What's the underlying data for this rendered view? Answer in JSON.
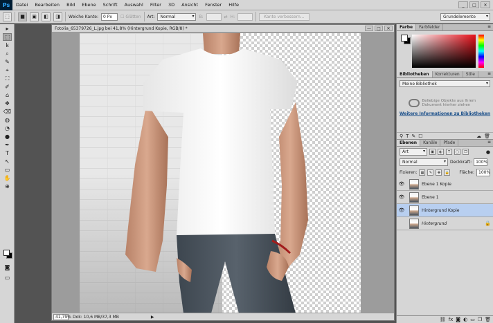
{
  "app": {
    "logo": "Ps"
  },
  "menu": [
    "Datei",
    "Bearbeiten",
    "Bild",
    "Ebene",
    "Schrift",
    "Auswahl",
    "Filter",
    "3D",
    "Ansicht",
    "Fenster",
    "Hilfe"
  ],
  "window_controls": [
    "_",
    "□",
    "✕"
  ],
  "options": {
    "soft_edge_label": "Weiche Kante:",
    "soft_edge_value": "0 Px",
    "smooth_label": "Glätten",
    "style_label": "Art:",
    "style_value": "Normal",
    "width_label": "B:",
    "height_label": "H:",
    "refine_button": "Kante verbessern...",
    "workspace": "Grundelemente"
  },
  "tools": [
    "▸",
    "⬚",
    "ꝃ",
    "⌕",
    "✎",
    "⌖",
    "⛶",
    "✐",
    "⌂",
    "❖",
    "⌫",
    "◍",
    "◔",
    "●",
    "✒",
    "T",
    "↖",
    "▭",
    "✋",
    "⊕"
  ],
  "document": {
    "title": "Fotolia_65379726_L.jpg bei 41,8% (Hintergrund Kopie, RGB/8) *",
    "zoom": "41,79%",
    "info": "Dok: 10,6 MB/37,3 MB",
    "controls": [
      "—",
      "□",
      "✕"
    ]
  },
  "panels": {
    "color_tabs": [
      "Farbe",
      "Farbfelder"
    ],
    "library_tabs": [
      "Bibliotheken",
      "Korrekturen",
      "Stile"
    ],
    "library_select": "Meine Bibliothek",
    "library_hint": "Beliebige Objekte aus Ihrem Dokument hierher ziehen",
    "library_link": "Weitere Informationen zu Bibliotheken",
    "layer_tabs": [
      "Ebenen",
      "Kanäle",
      "Pfade"
    ],
    "filter_select": "Art",
    "blend_mode": "Normal",
    "opacity_label": "Deckkraft:",
    "opacity_value": "100%",
    "lock_label": "Fixieren:",
    "fill_label": "Fläche:",
    "fill_value": "100%"
  },
  "layers": [
    {
      "name": "Ebene 1 Kopie",
      "visible": true,
      "selected": false,
      "locked": false
    },
    {
      "name": "Ebene 1",
      "visible": true,
      "selected": false,
      "locked": false
    },
    {
      "name": "Hintergrund Kopie",
      "visible": true,
      "selected": true,
      "locked": false
    },
    {
      "name": "Hintergrund",
      "visible": false,
      "selected": false,
      "locked": true
    }
  ],
  "colors": {
    "selection": "#b8cff0",
    "panel_bg": "#d6d6d6",
    "workspace_bg": "#535353"
  }
}
